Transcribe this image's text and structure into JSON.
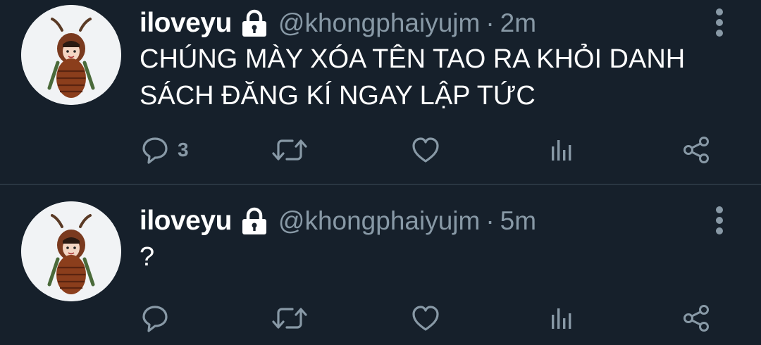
{
  "theme": {
    "background": "#16202b",
    "text": "#ffffff",
    "muted": "#8899a6",
    "divider": "#2a3642"
  },
  "tweets": [
    {
      "name": "iloveyu",
      "handle": "@khongphaiyujm",
      "separator": "·",
      "time": "2m",
      "text": "CHÚNG MÀY XÓA TÊN TAO RA KHỎI DANH SÁCH ĐĂNG KÍ NGAY LẬP TỨC",
      "reply_count": "3",
      "icons": [
        "lock-icon",
        "more-icon",
        "reply-icon",
        "retweet-icon",
        "like-icon",
        "views-icon",
        "share-icon"
      ]
    },
    {
      "name": "iloveyu",
      "handle": "@khongphaiyujm",
      "separator": "·",
      "time": "5m",
      "text": "?",
      "reply_count": "",
      "icons": [
        "lock-icon",
        "more-icon",
        "reply-icon",
        "retweet-icon",
        "like-icon",
        "views-icon",
        "share-icon"
      ]
    }
  ]
}
